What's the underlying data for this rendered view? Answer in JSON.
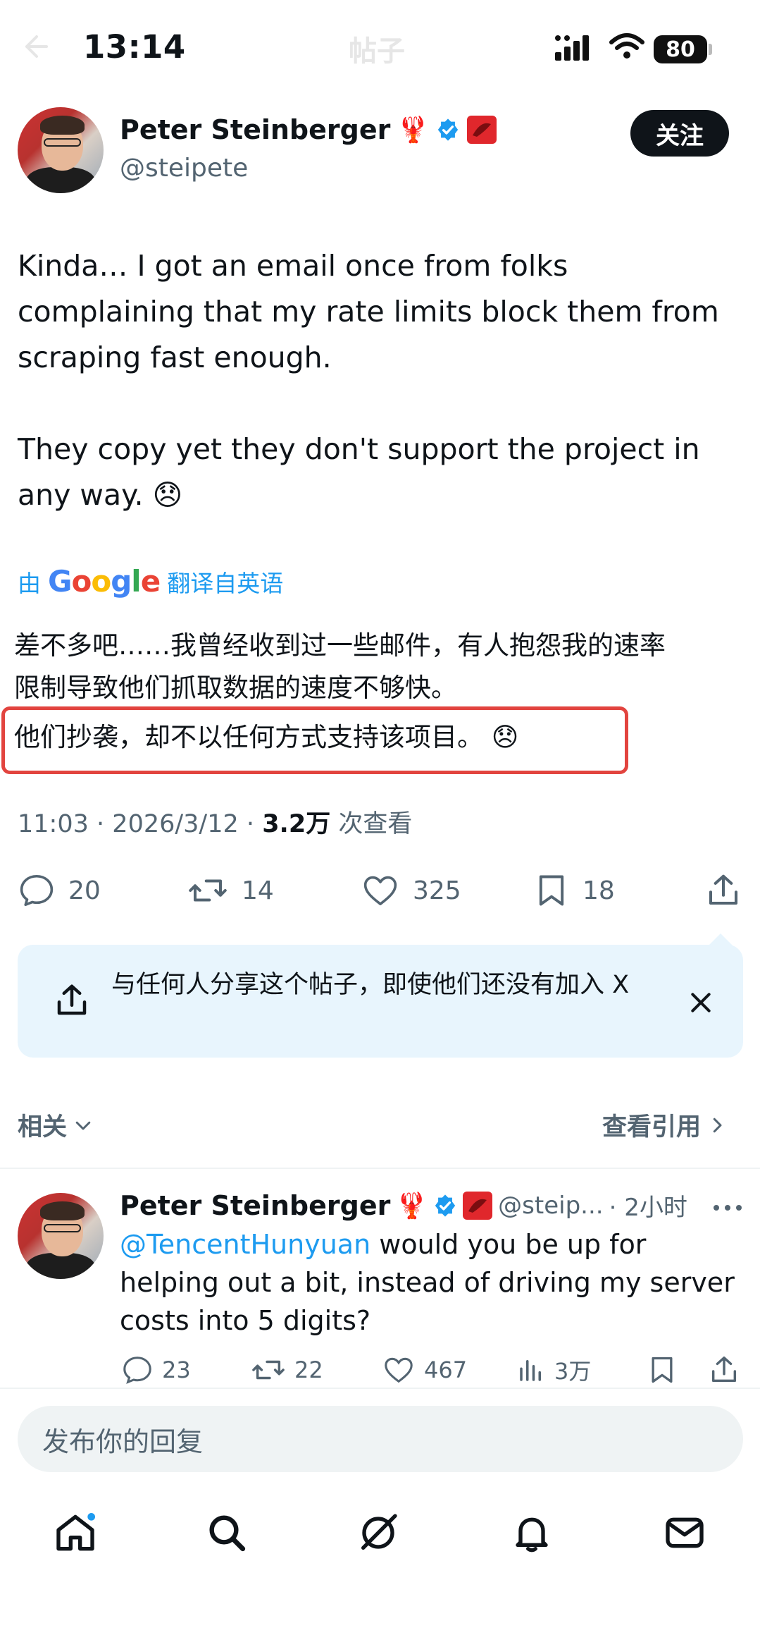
{
  "status_bar": {
    "time": "13:14",
    "title": "帖子",
    "battery": "80"
  },
  "post": {
    "author": {
      "name": "Peter Steinberger",
      "handle": "@steipete",
      "emoji": "🦞"
    },
    "follow_label": "关注",
    "text": "Kinda… I got an email once from folks\ncomplaining that my rate limits block them from\nscraping fast enough.\n\nThey copy yet they don't support the project in\nany way. 😞",
    "translation": {
      "prefix": "由",
      "brand": "Google",
      "suffix": "翻译自英语",
      "line1": "差不多吧……我曾经收到过一些邮件，有人抱怨我的速率",
      "line2": "限制导致他们抓取数据的速度不够快。",
      "line3": "他们抄袭，却不以任何方式支持该项目。 😞"
    },
    "meta": {
      "time": "11:03",
      "date": "2026/3/12",
      "views_count": "3.2万",
      "views_label": "次查看",
      "sep": "·"
    },
    "actions": {
      "replies": "20",
      "retweets": "14",
      "likes": "325",
      "bookmarks": "18"
    }
  },
  "share_prompt": {
    "text": "与任何人分享这个帖子，即使他们还没有加入 X"
  },
  "section": {
    "related": "相关",
    "view_quotes": "查看引用"
  },
  "reply": {
    "author": {
      "name": "Peter Steinberger",
      "emoji": "🦞",
      "handle": "@steip...",
      "time": "· 2小时"
    },
    "mention": "@TencentHunyuan",
    "text": " would you be up for helping out a bit, instead of driving my server costs into 5 digits?",
    "actions": {
      "replies": "23",
      "retweets": "22",
      "likes": "467",
      "views": "3万"
    }
  },
  "reply_input": {
    "placeholder": "发布你的回复"
  },
  "colors": {
    "accent": "#1d9bf0",
    "highlight_border": "#e2443f",
    "text": "#0f1419",
    "muted": "#536471"
  }
}
